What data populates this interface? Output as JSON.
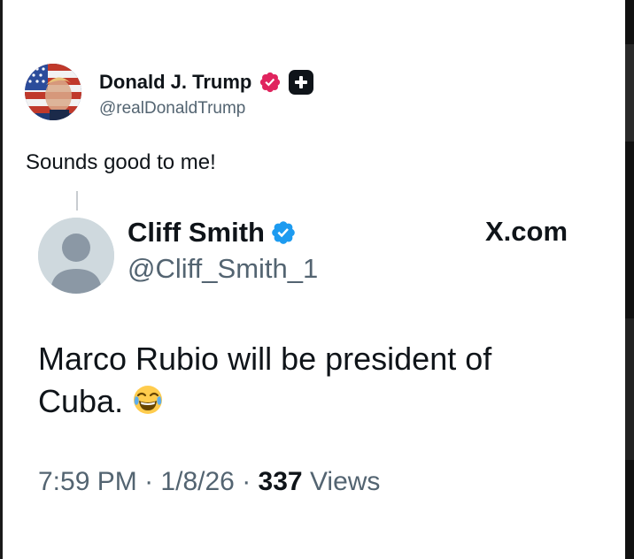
{
  "outer_tweet": {
    "author_name": "Donald J. Trump",
    "author_handle": "@realDonaldTrump",
    "text": "Sounds good to me!",
    "badge_color": "#e0245e"
  },
  "quoted_tweet": {
    "author_name": "Cliff Smith",
    "author_handle": "@Cliff_Smith_1",
    "source": "X.com",
    "text": "Marco Rubio will be president of Cuba.",
    "emoji_icon": "face-with-tears-of-joy",
    "time": "7:59 PM",
    "date": "1/8/26",
    "separator": "·",
    "views_count": "337",
    "views_label": "Views",
    "badge_color": "#1d9bf0"
  },
  "colors": {
    "text_primary": "#0f1419",
    "text_secondary": "#536471",
    "verified_blue": "#1d9bf0",
    "verified_pink": "#e0245e"
  }
}
